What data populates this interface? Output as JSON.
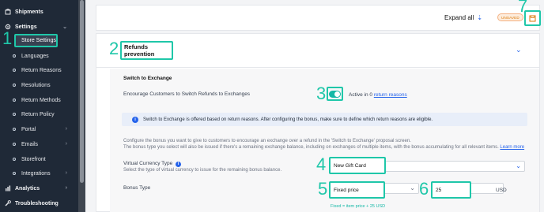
{
  "sidebar": {
    "items": [
      {
        "label": "Shipments",
        "icon": "box-icon",
        "top": true
      },
      {
        "label": "Settings",
        "icon": "gear-icon",
        "top": true,
        "chevron": "chevron-down-icon"
      },
      {
        "label": "Store Settings",
        "active": true
      },
      {
        "label": "Languages"
      },
      {
        "label": "Return Reasons"
      },
      {
        "label": "Resolutions"
      },
      {
        "label": "Return Methods"
      },
      {
        "label": "Return Policy"
      },
      {
        "label": "Portal",
        "chevron": "chevron-right-icon"
      },
      {
        "label": "Emails",
        "chevron": "chevron-right-icon"
      },
      {
        "label": "Storefront"
      },
      {
        "label": "Integrations",
        "chevron": "chevron-right-icon"
      },
      {
        "label": "Analytics",
        "icon": "bar-chart-icon",
        "top": true,
        "chevron": "chevron-right-icon"
      },
      {
        "label": "Troubleshooting",
        "icon": "wrench-icon",
        "top": true
      }
    ]
  },
  "header": {
    "expand_label": "Expand all",
    "badge": "UNSAVED"
  },
  "card": {
    "title": "Refunds prevention",
    "section_title": "Switch to Exchange",
    "toggle_label": "Encourage Customers to Switch Refunds to Exchanges",
    "toggle_on": true,
    "active_text_prefix": "Active in 0",
    "active_link": "return reasons",
    "info_text": "Switch to Exchange is offered based on return reasons. After configuring the bonus, make sure to define which return reasons are eligible.",
    "desc_line1": "Configure the bonus you want to give to customers to encourage an exchange over a refund in the 'Switch to Exchange' proposal screen.",
    "desc_line2": "The bonus type you select will also be issued if there's a remaining exchange balance, including on exchanges of multiple items, with the bonus accumulating for all relevant items.",
    "learn_more": "Learn more",
    "vc_label": "Virtual Currency Type",
    "vc_help": "Select the type of virtual currency to issue for the remaining bonus balance.",
    "vc_value": "New Gift Card",
    "bonus_label": "Bonus Type",
    "bonus_type": "Fixed price",
    "bonus_amount": "25",
    "currency": "USD",
    "formula": "Fixed = item price + 25 USD"
  },
  "annotations": [
    "1",
    "2",
    "3",
    "4",
    "5",
    "6",
    "7"
  ],
  "colors": {
    "accent": "#1fc7a9",
    "sidebar": "#1f2937",
    "link": "#2563eb",
    "toggle": "#14b8a6",
    "badge_text": "#d97706"
  }
}
